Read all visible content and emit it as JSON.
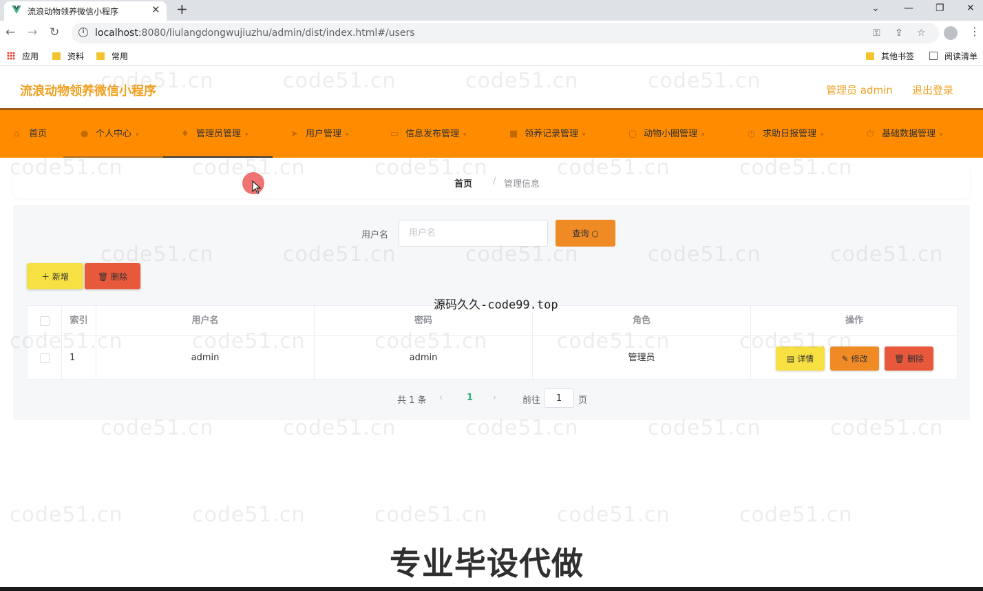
{
  "browser": {
    "tab_title": "流浪动物领养微信小程序",
    "tab_close": "✕",
    "new_tab": "+",
    "url_host": "localhost",
    "url_rest": ":8080/liulangdongwujiuzhu/admin/dist/index.html#/users",
    "bookmarks": {
      "apps": "应用",
      "folder1": "资料",
      "folder2": "常用",
      "other": "其他书签",
      "reading": "阅读清单"
    }
  },
  "header": {
    "title": "流浪动物领养微信小程序",
    "user": "管理员 admin",
    "logout": "退出登录"
  },
  "menu": [
    {
      "label": "首页",
      "icon": "home-icon"
    },
    {
      "label": "个人中心",
      "icon": "user-icon"
    },
    {
      "label": "管理员管理",
      "icon": "mic-icon"
    },
    {
      "label": "用户管理",
      "icon": "send-icon"
    },
    {
      "label": "信息发布管理",
      "icon": "doc-icon"
    },
    {
      "label": "领养记录管理",
      "icon": "chat-icon"
    },
    {
      "label": "动物小圈管理",
      "icon": "calendar-icon"
    },
    {
      "label": "求助日报管理",
      "icon": "time-icon"
    },
    {
      "label": "基础数据管理",
      "icon": "power-icon"
    }
  ],
  "breadcrumb": {
    "home": "首页",
    "separator": "/",
    "current": "管理信息"
  },
  "search": {
    "label": "用户名",
    "placeholder": "用户名",
    "button": "查询"
  },
  "actions": {
    "add": "新增",
    "delete": "删除"
  },
  "overlay_text": "源码久久-code99.top",
  "table": {
    "headers": {
      "index": "索引",
      "username": "用户名",
      "password": "密码",
      "role": "角色",
      "ops": "操作"
    },
    "rows": [
      {
        "index": "1",
        "username": "admin",
        "password": "admin",
        "role": "管理员"
      }
    ],
    "row_buttons": {
      "detail": "详情",
      "edit": "修改",
      "delete": "删除"
    }
  },
  "pagination": {
    "total": "共 1 条",
    "current": "1",
    "goto": "前往",
    "page_input": "1",
    "page_unit": "页"
  },
  "watermark": "code51.cn",
  "caption": "专业毕设代做",
  "colors": {
    "accent": "#ff8c00",
    "title": "#f0a020",
    "yellow_button": "#f7e042",
    "orange_button": "#f08a24",
    "red_button": "#e7593a",
    "pager_active": "#2ab27b"
  }
}
